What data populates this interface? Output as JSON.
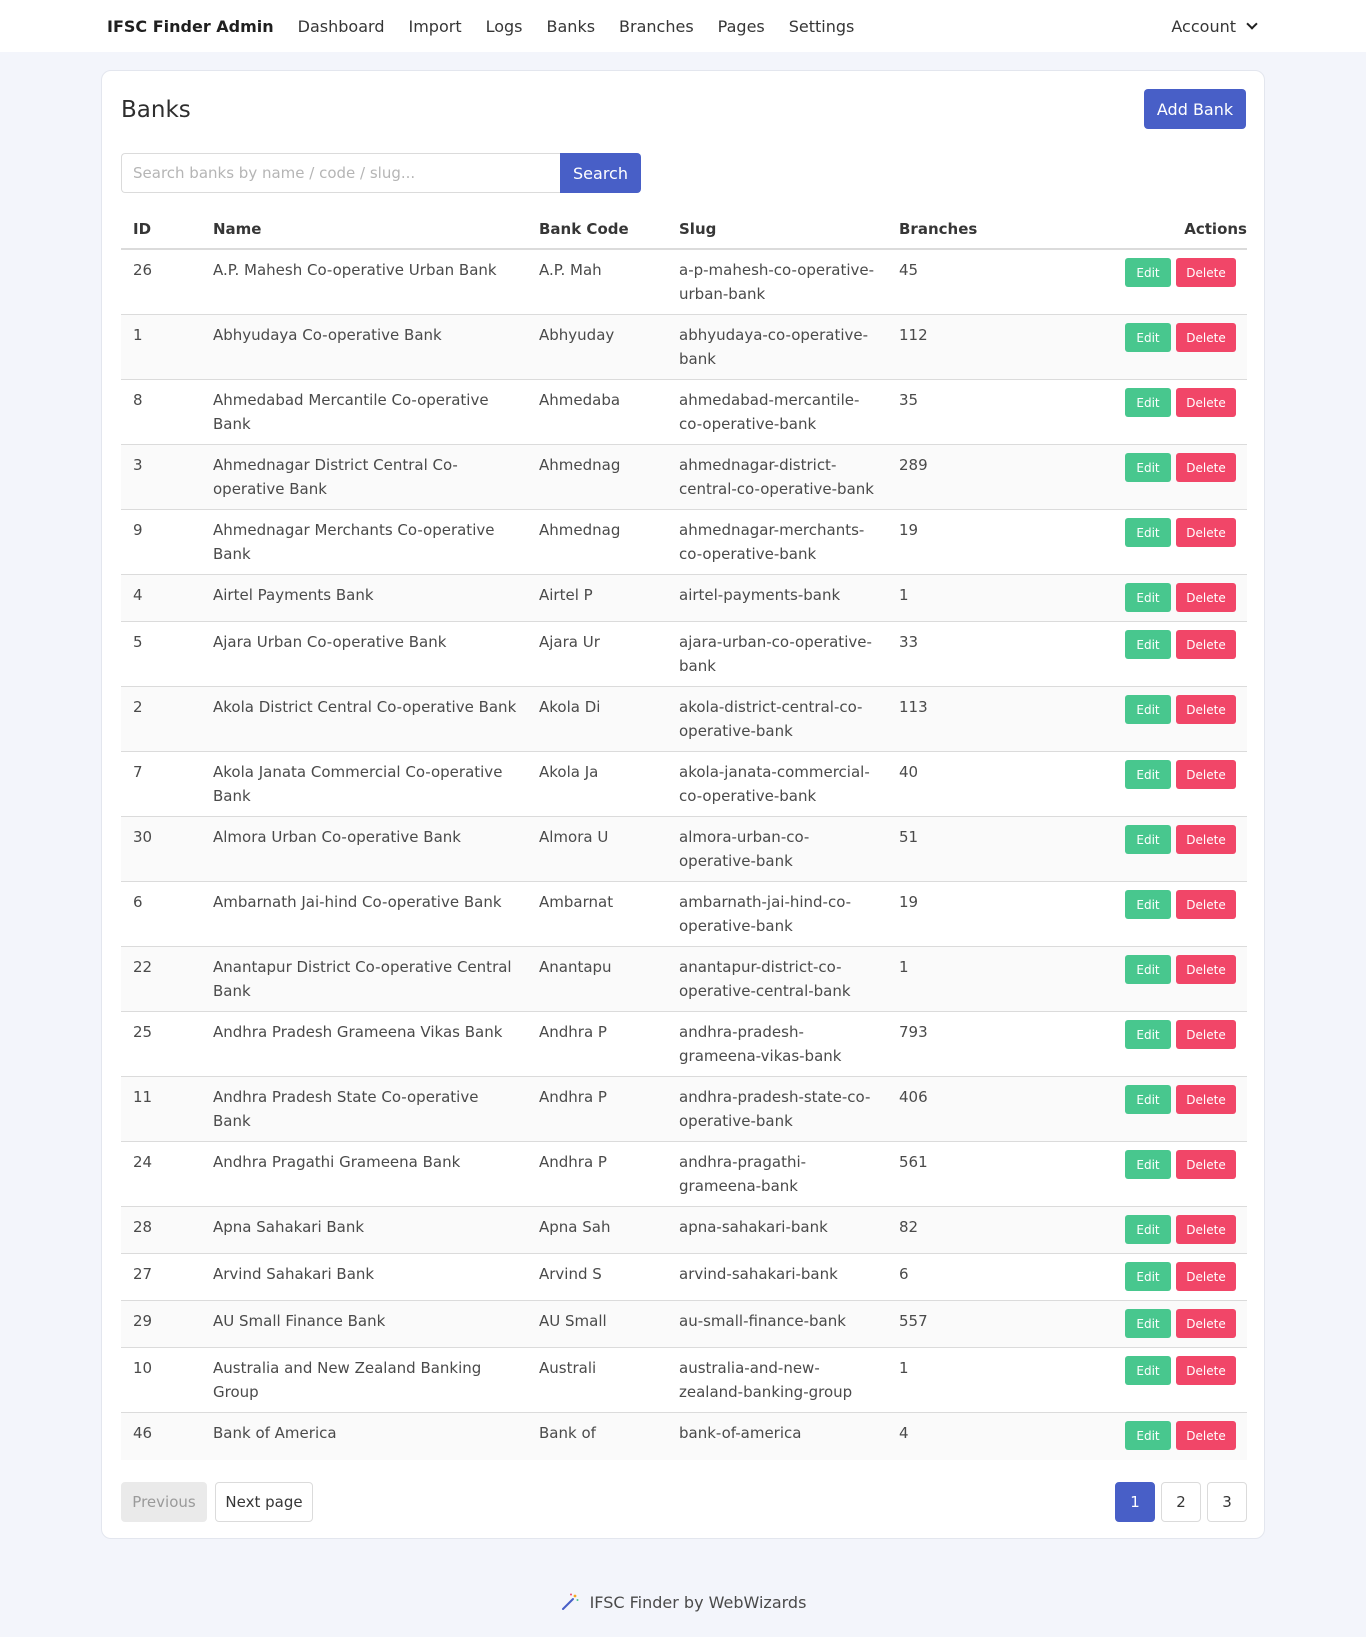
{
  "navbar": {
    "brand": "IFSC Finder Admin",
    "items": [
      "Dashboard",
      "Import",
      "Logs",
      "Banks",
      "Branches",
      "Pages",
      "Settings"
    ],
    "account": "Account"
  },
  "page": {
    "title": "Banks",
    "add_button": "Add Bank",
    "search_placeholder": "Search banks by name / code / slug...",
    "search_button": "Search"
  },
  "table": {
    "headers": {
      "id": "ID",
      "name": "Name",
      "code": "Bank Code",
      "slug": "Slug",
      "branches": "Branches",
      "actions": "Actions"
    },
    "edit_label": "Edit",
    "delete_label": "Delete",
    "rows": [
      {
        "id": "26",
        "name": "A.P. Mahesh Co-operative Urban Bank",
        "code": "A.P. Mah",
        "slug": "a-p-mahesh-co-operative-urban-bank",
        "branches": "45",
        "lines": 2
      },
      {
        "id": "1",
        "name": "Abhyudaya Co-operative Bank",
        "code": "Abhyuday",
        "slug": "abhyudaya-co-operative-bank",
        "branches": "112",
        "lines": 2
      },
      {
        "id": "8",
        "name": "Ahmedabad Mercantile Co-operative Bank",
        "code": "Ahmedaba",
        "slug": "ahmedabad-mercantile-co-operative-bank",
        "branches": "35",
        "lines": 2
      },
      {
        "id": "3",
        "name": "Ahmednagar District Central Co-operative Bank",
        "code": "Ahmednag",
        "slug": "ahmednagar-district-central-co-operative-bank",
        "branches": "289",
        "lines": 2
      },
      {
        "id": "9",
        "name": "Ahmednagar Merchants Co-operative Bank",
        "code": "Ahmednag",
        "slug": "ahmednagar-merchants-co-operative-bank",
        "branches": "19",
        "lines": 2
      },
      {
        "id": "4",
        "name": "Airtel Payments Bank",
        "code": "Airtel P",
        "slug": "airtel-payments-bank",
        "branches": "1",
        "lines": 1
      },
      {
        "id": "5",
        "name": "Ajara Urban Co-operative Bank",
        "code": "Ajara Ur",
        "slug": "ajara-urban-co-operative-bank",
        "branches": "33",
        "lines": 2
      },
      {
        "id": "2",
        "name": "Akola District Central Co-operative Bank",
        "code": "Akola Di",
        "slug": "akola-district-central-co-operative-bank",
        "branches": "113",
        "lines": 2
      },
      {
        "id": "7",
        "name": "Akola Janata Commercial Co-operative Bank",
        "code": "Akola Ja",
        "slug": "akola-janata-commercial-co-operative-bank",
        "branches": "40",
        "lines": 2
      },
      {
        "id": "30",
        "name": "Almora Urban Co-operative Bank",
        "code": "Almora U",
        "slug": "almora-urban-co-operative-bank",
        "branches": "51",
        "lines": 2
      },
      {
        "id": "6",
        "name": "Ambarnath Jai-hind Co-operative Bank",
        "code": "Ambarnat",
        "slug": "ambarnath-jai-hind-co-operative-bank",
        "branches": "19",
        "lines": 2
      },
      {
        "id": "22",
        "name": "Anantapur District Co-operative Central Bank",
        "code": "Anantapu",
        "slug": "anantapur-district-co-operative-central-bank",
        "branches": "1",
        "lines": 2
      },
      {
        "id": "25",
        "name": "Andhra Pradesh Grameena Vikas Bank",
        "code": "Andhra P",
        "slug": "andhra-pradesh-grameena-vikas-bank",
        "branches": "793",
        "lines": 2
      },
      {
        "id": "11",
        "name": "Andhra Pradesh State Co-operative Bank",
        "code": "Andhra P",
        "slug": "andhra-pradesh-state-co-operative-bank",
        "branches": "406",
        "lines": 2
      },
      {
        "id": "24",
        "name": "Andhra Pragathi Grameena Bank",
        "code": "Andhra P",
        "slug": "andhra-pragathi-grameena-bank",
        "branches": "561",
        "lines": 2
      },
      {
        "id": "28",
        "name": "Apna Sahakari Bank",
        "code": "Apna Sah",
        "slug": "apna-sahakari-bank",
        "branches": "82",
        "lines": 1
      },
      {
        "id": "27",
        "name": "Arvind Sahakari Bank",
        "code": "Arvind S",
        "slug": "arvind-sahakari-bank",
        "branches": "6",
        "lines": 1
      },
      {
        "id": "29",
        "name": "AU Small Finance Bank",
        "code": "AU Small",
        "slug": "au-small-finance-bank",
        "branches": "557",
        "lines": 1
      },
      {
        "id": "10",
        "name": "Australia and New Zealand Banking Group",
        "code": "Australi",
        "slug": "australia-and-new-zealand-banking-group",
        "branches": "1",
        "lines": 2
      },
      {
        "id": "46",
        "name": "Bank of America",
        "code": "Bank of",
        "slug": "bank-of-america",
        "branches": "4",
        "lines": 1
      }
    ]
  },
  "pagination": {
    "previous": "Previous",
    "next": "Next page",
    "pages": [
      "1",
      "2",
      "3"
    ],
    "current": "1"
  },
  "footer": {
    "text": "IFSC Finder by WebWizards",
    "icon": "magic-wand-icon"
  },
  "colors": {
    "primary": "#485fc7",
    "success": "#48c78e",
    "danger": "#f14668"
  }
}
